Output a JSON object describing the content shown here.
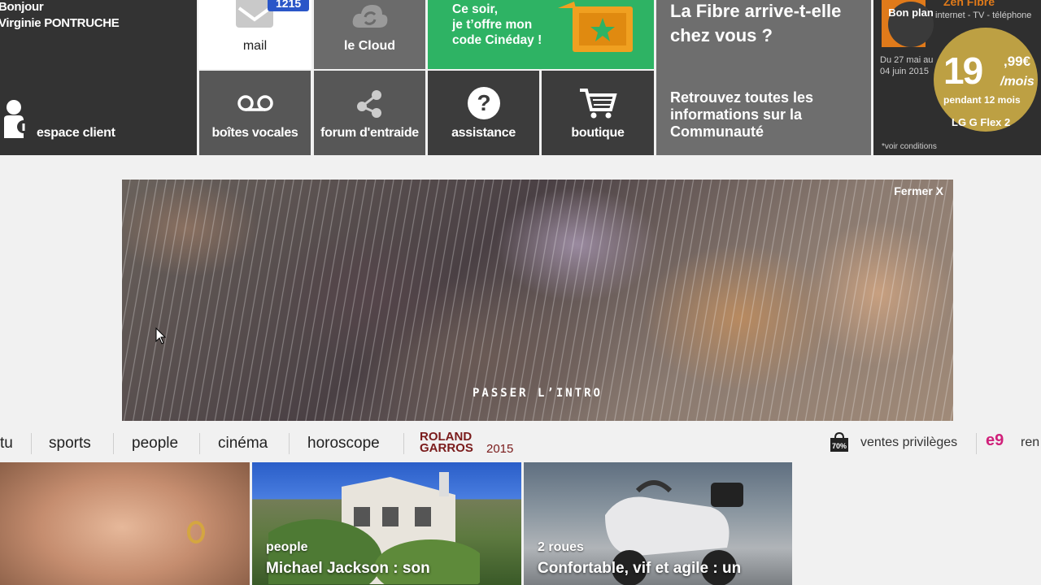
{
  "tiles": {
    "user": {
      "greeting": "Bonjour",
      "name": "Virginie PONTRUCHE",
      "label": "espace client"
    },
    "mail": {
      "label": "mail",
      "badge": "1215"
    },
    "cloud": {
      "label": "le Cloud"
    },
    "cineday": {
      "line1": "Ce soir,",
      "line2": "je t’offre mon",
      "line3": "code Cinéday !"
    },
    "fibre": {
      "heading_line1": "La Fibre arrive-t-elle",
      "heading_line2": "chez vous ?",
      "text_line1": "Retrouvez toutes les",
      "text_line2": "informations sur la",
      "text_line3": "Communauté"
    },
    "promo": {
      "bon_plan": "Bon plan",
      "top_text": "internet - TV - téléphone",
      "offer": "Zen Fibre",
      "dates_line1": "Du 27 mai au",
      "dates_line2": "04 juin 2015",
      "price": "19",
      "price_cents": ",99€",
      "per_month": "/mois",
      "duration": "pendant 12 mois",
      "device": "LG G Flex 2",
      "conditions": "*voir conditions"
    },
    "vocal": {
      "label": "boîtes vocales"
    },
    "forum": {
      "label": "forum d'entraide"
    },
    "assist": {
      "label": "assistance"
    },
    "shop": {
      "label": "boutique"
    }
  },
  "banner": {
    "close": "Fermer X",
    "skip": "PASSER L’INTRO"
  },
  "nav": {
    "items": [
      "tu",
      "sports",
      "people",
      "cinéma",
      "horoscope"
    ],
    "rg_line1": "ROLAND",
    "rg_line2": "GARROS",
    "rg_year": "2015",
    "ventes": "ventes privilèges",
    "ventes_badge": "70%",
    "rencontres": "ren"
  },
  "cards": [
    {
      "category": "",
      "title": ""
    },
    {
      "category": "people",
      "title": "Michael Jackson : son"
    },
    {
      "category": "2 roues",
      "title": "Confortable, vif et agile : un"
    }
  ],
  "colors": {
    "green": "#2eb364",
    "badge_blue": "#2a56c8",
    "rg_red": "#7a1b1b"
  }
}
